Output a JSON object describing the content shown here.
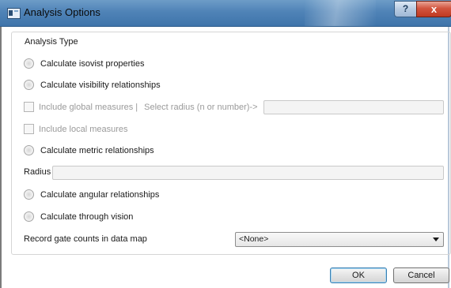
{
  "window": {
    "title": "Analysis Options",
    "help_glyph": "?",
    "close_glyph": "x"
  },
  "group": {
    "title": "Analysis Type"
  },
  "options": {
    "isovist": "Calculate isovist properties",
    "visibility": "Calculate visibility relationships",
    "global_measures": "Include global measures |",
    "select_radius": "Select radius (n or number)->",
    "local_measures": "Include local measures",
    "metric": "Calculate metric relationships",
    "radius_label": "Radius",
    "angular": "Calculate angular relationships",
    "through_vision": "Calculate through vision",
    "gate_counts_label": "Record gate counts in data map"
  },
  "fields": {
    "radius_global_value": "",
    "radius_metric_value": ""
  },
  "gate_counts_select": {
    "selected": "<None>"
  },
  "buttons": {
    "ok": "OK",
    "cancel": "Cancel"
  },
  "colors": {
    "titlebar": "#4f83b7",
    "close_button": "#c03a22",
    "default_button_border": "#3c7fb1"
  }
}
